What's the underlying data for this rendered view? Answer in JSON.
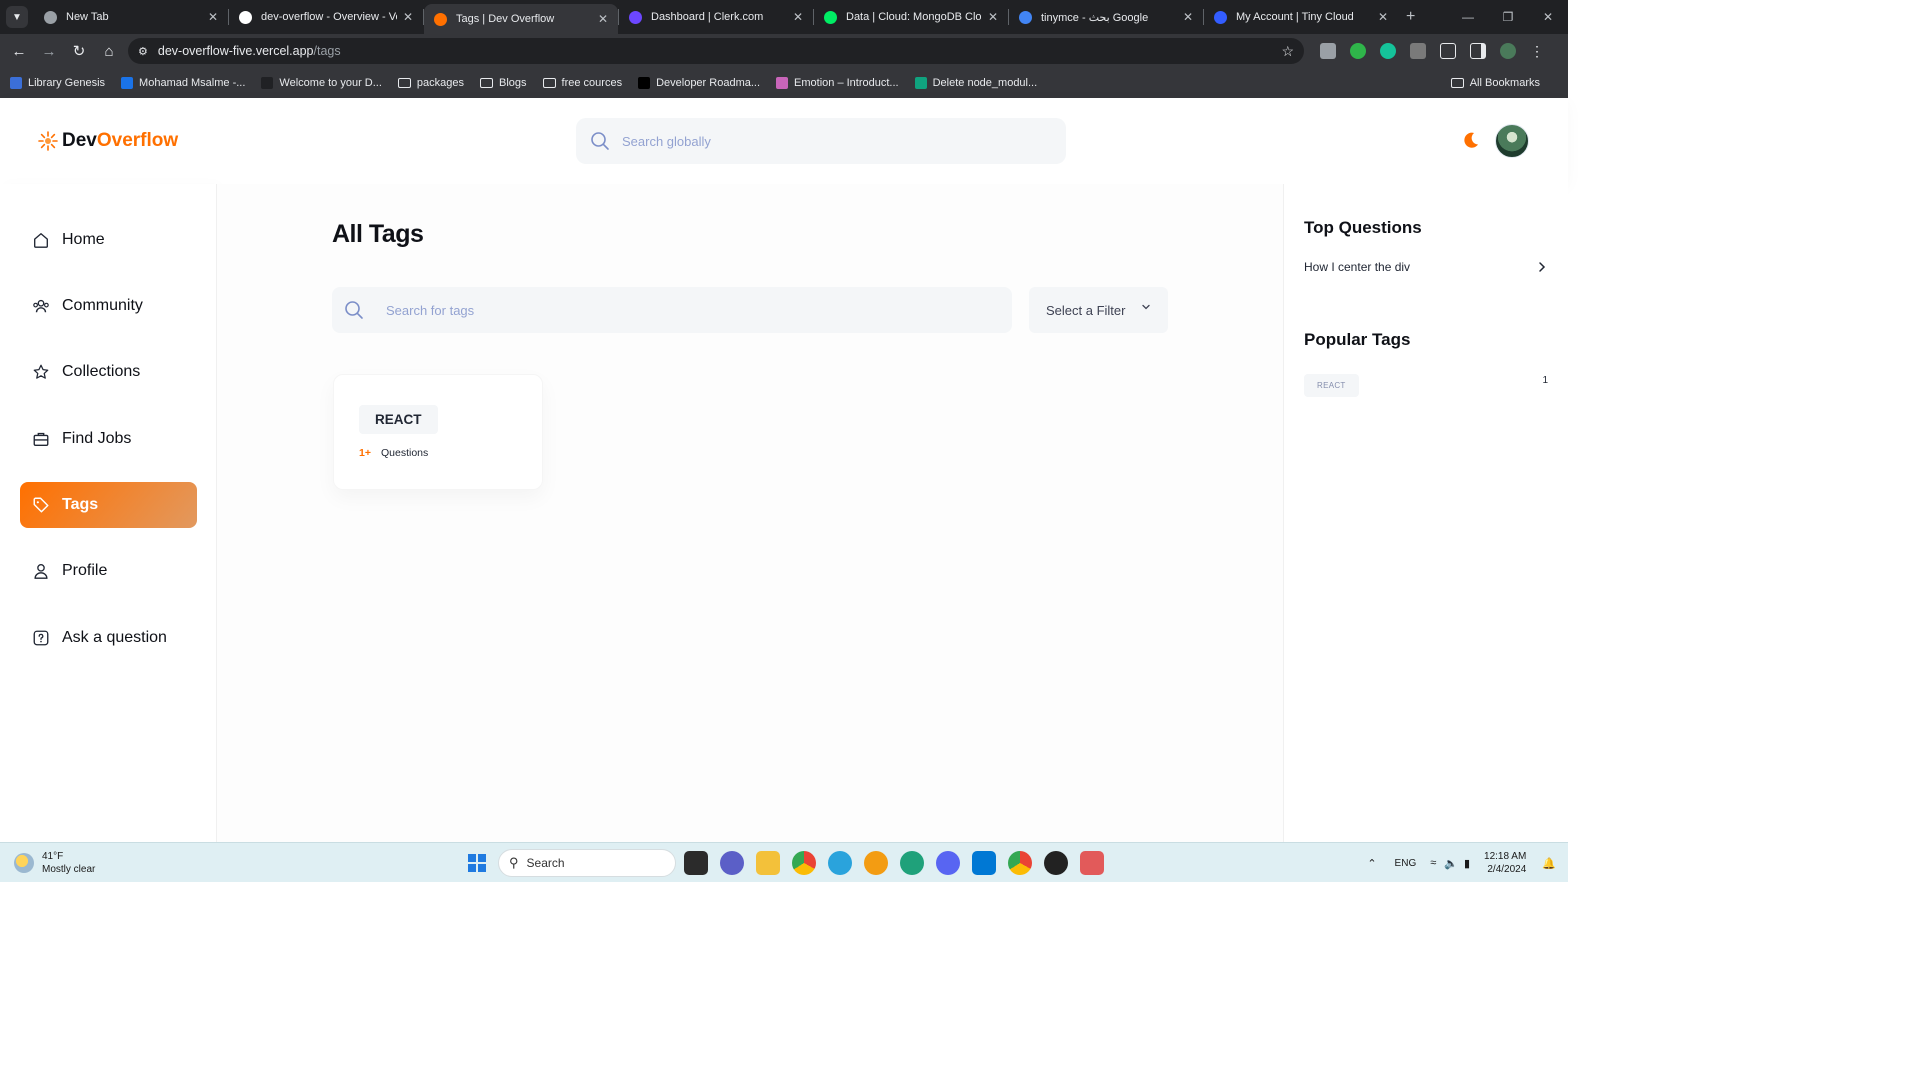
{
  "browser": {
    "tabs": [
      {
        "title": "New Tab",
        "favicon_color": "#9aa0a6",
        "active": false
      },
      {
        "title": "dev-overflow - Overview - Verc",
        "favicon_color": "#ffffff",
        "active": false
      },
      {
        "title": "Tags | Dev Overflow",
        "favicon_color": "#ff7000",
        "active": true
      },
      {
        "title": "Dashboard | Clerk.com",
        "favicon_color": "#6c47ff",
        "active": false
      },
      {
        "title": "Data | Cloud: MongoDB Cloud",
        "favicon_color": "#00ed64",
        "active": false
      },
      {
        "title": "tinymce - بحث Google",
        "favicon_color": "#4285f4",
        "active": false
      },
      {
        "title": "My Account | Tiny Cloud",
        "favicon_color": "#335dff",
        "active": false
      }
    ],
    "url_host": "dev-overflow-five.vercel.app",
    "url_path": "/tags",
    "bookmarks": [
      {
        "label": "Library Genesis",
        "type": "site",
        "color": "#3b6fd8"
      },
      {
        "label": "Mohamad Msalme -...",
        "type": "site",
        "color": "#1a73e8"
      },
      {
        "label": "Welcome to your D...",
        "type": "site",
        "color": "#202124"
      },
      {
        "label": "packages",
        "type": "folder"
      },
      {
        "label": "Blogs",
        "type": "folder"
      },
      {
        "label": "free cources",
        "type": "folder"
      },
      {
        "label": "Developer Roadma...",
        "type": "site",
        "color": "#000000"
      },
      {
        "label": "Emotion – Introduct...",
        "type": "site",
        "color": "#c865b9"
      },
      {
        "label": "Delete node_modul...",
        "type": "site",
        "color": "#10a37f"
      }
    ],
    "all_bookmarks": "All Bookmarks"
  },
  "app": {
    "logo_dev": "Dev",
    "logo_overflow": "Overflow",
    "global_search_placeholder": "Search globally",
    "accent": "#ff7000"
  },
  "sidebar": {
    "items": [
      {
        "label": "Home",
        "icon": "home-icon",
        "active": false
      },
      {
        "label": "Community",
        "icon": "users-icon",
        "active": false
      },
      {
        "label": "Collections",
        "icon": "star-icon",
        "active": false
      },
      {
        "label": "Find Jobs",
        "icon": "suitcase-icon",
        "active": false
      },
      {
        "label": "Tags",
        "icon": "tag-icon",
        "active": true
      },
      {
        "label": "Profile",
        "icon": "user-icon",
        "active": false
      },
      {
        "label": "Ask a question",
        "icon": "question-icon",
        "active": false
      }
    ]
  },
  "main": {
    "title": "All Tags",
    "search_placeholder": "Search for tags",
    "filter_label": "Select a Filter",
    "tags": [
      {
        "name": "REACT",
        "count": "1+",
        "count_label": "Questions"
      }
    ]
  },
  "right_sidebar": {
    "top_questions_heading": "Top Questions",
    "top_questions": [
      "How I center the div"
    ],
    "popular_tags_heading": "Popular Tags",
    "popular_tags": [
      {
        "name": "REACT",
        "count": "1"
      }
    ]
  },
  "taskbar": {
    "temperature": "41°F",
    "weather": "Mostly clear",
    "search_label": "Search",
    "language": "ENG",
    "time": "12:18 AM",
    "date": "2/4/2024"
  }
}
